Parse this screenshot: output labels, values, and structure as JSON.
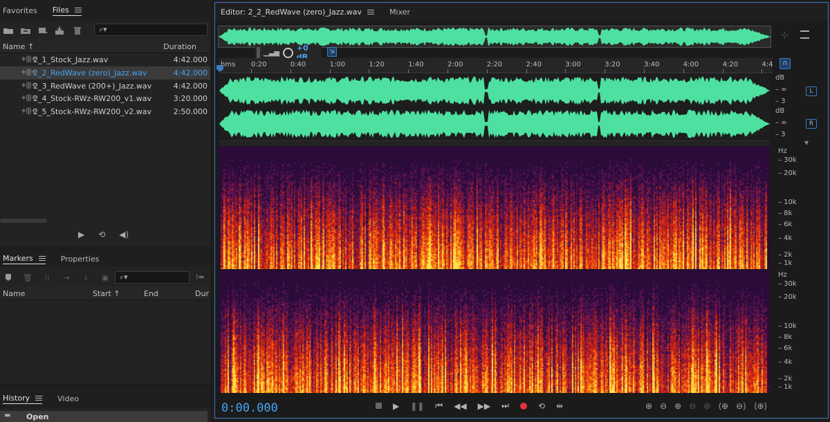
{
  "files_panel": {
    "tabs": [
      {
        "label": "Favorites"
      },
      {
        "label": "Files"
      }
    ],
    "col_name": "Name ↑",
    "col_duration": "Duration",
    "files": [
      {
        "name": "2_1_Stock_Jazz.wav",
        "duration": "4:42.000",
        "selected": false
      },
      {
        "name": "2_2_RedWave (zero)_Jazz.wav",
        "duration": "4:42.000",
        "selected": true
      },
      {
        "name": "2_3_RedWave (200+)_Jazz.wav",
        "duration": "4:42.000",
        "selected": false
      },
      {
        "name": "2_4_Stock-RWz-RW200_v1.wav",
        "duration": "3:20.000",
        "selected": false
      },
      {
        "name": "2_5_Stock-RWz-RW200_v2.wav",
        "duration": "2:50.000",
        "selected": false
      }
    ],
    "search_placeholder": "⌕▾"
  },
  "markers_panel": {
    "tabs": [
      {
        "label": "Markers"
      },
      {
        "label": "Properties"
      }
    ],
    "col_name": "Name",
    "col_start": "Start ↑",
    "col_end": "End",
    "col_dur": "Dur",
    "search_placeholder": "⌕▾"
  },
  "history_panel": {
    "tabs": [
      {
        "label": "History"
      },
      {
        "label": "Video"
      }
    ],
    "item": "Open"
  },
  "editor": {
    "tab_title": "Editor: 2_2_RedWave (zero)_Jazz.wav",
    "mixer_tab": "Mixer",
    "volume": "+0 dB",
    "ruler_unit": "hms",
    "ruler_ticks": [
      "0:20",
      "0:40",
      "1:00",
      "1:20",
      "1:40",
      "2:00",
      "2:20",
      "2:40",
      "3:00",
      "3:20",
      "3:40",
      "4:00",
      "4:20",
      "4:4"
    ],
    "channel_left": "L",
    "channel_right": "R",
    "db_labels": {
      "db": "dB",
      "inf": "– ∞",
      "minus3": "– 3"
    },
    "hz_unit": "Hz",
    "hz_labels": [
      "30k",
      "20k",
      "10k",
      "8k",
      "6k",
      "4k",
      "2k",
      "1k"
    ],
    "timecode": "0:00.000"
  },
  "colors": {
    "waveform": "#4ee0a0",
    "accent": "#4aa3f0",
    "record": "#e8313a"
  }
}
